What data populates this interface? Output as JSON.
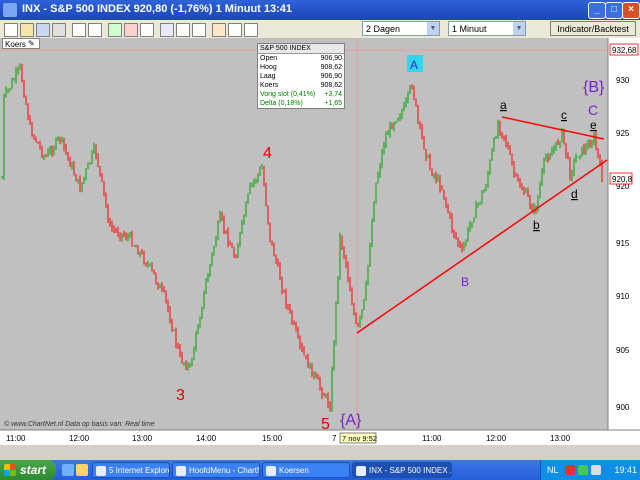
{
  "window": {
    "title": "INX - S&P 500 INDEX     920,80 (-1,76%)    1 Minuut  13:41",
    "min_label": "_",
    "max_label": "□",
    "close_label": "×"
  },
  "toolbar": {
    "period_value": "2 Dagen",
    "interval_value": "1 Minuut",
    "indicator_button": "Indicator/Backtest"
  },
  "chart": {
    "series_label": "Koers",
    "footer_text": "© www.ChartNet.nl   Data op basis van:   Real time",
    "current_date_label": "7 nov 9:52",
    "last_price_label": "920,8",
    "high_price_label": "932,68",
    "y_ticks": [
      "930",
      "925",
      "920",
      "915",
      "910",
      "905",
      "900"
    ],
    "x_ticks": [
      "11:00",
      "12:00",
      "13:00",
      "14:00",
      "15:00",
      "7",
      "11:00",
      "12:00",
      "13:00"
    ],
    "info": {
      "title": "S&P 500 INDEX",
      "rows": [
        {
          "label": "Open",
          "value": "906,90"
        },
        {
          "label": "Hoog",
          "value": "908,62"
        },
        {
          "label": "Laag",
          "value": "906,90"
        },
        {
          "label": "Koers",
          "value": "908,62"
        },
        {
          "label": "Vorig slot (0,41%)",
          "value": "+3,74"
        },
        {
          "label": "Delta (0,18%)",
          "value": "+1,65"
        }
      ]
    },
    "wave_labels": {
      "w3": "3",
      "w4": "4",
      "w5": "5",
      "bigA": "{A}",
      "A": "A",
      "B": "B",
      "a": "a",
      "b": "b",
      "c": "c",
      "d": "d",
      "e": "e",
      "bigB": "{B}",
      "C": "C"
    },
    "colors": {
      "up": "#00a000",
      "down": "#ff0000",
      "trendline": "#ff0000",
      "wave_red": "#e00000",
      "wave_purple": "#7a22c8",
      "A_bg": "#33d6e8"
    }
  },
  "taskbar": {
    "start_label": "start",
    "tasks": [
      {
        "label": "5 Internet Explorer",
        "icon": "ie-icon"
      },
      {
        "label": "HoofdMenu - ChartNet",
        "icon": "chartnet-icon"
      },
      {
        "label": "Koersen",
        "icon": "chartnet-icon"
      },
      {
        "label": "INX - S&P 500 INDEX ...",
        "icon": "chartnet-icon"
      }
    ],
    "language": "NL",
    "clock": "19:41"
  }
}
